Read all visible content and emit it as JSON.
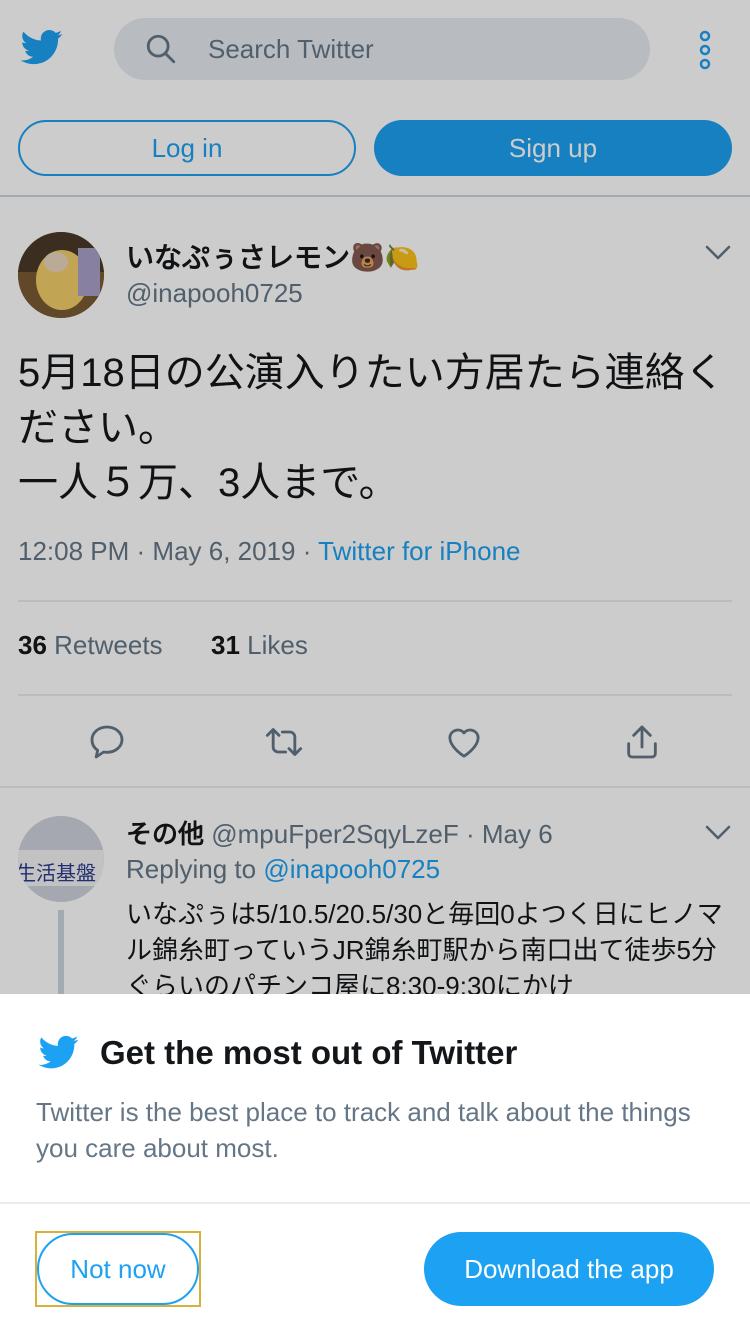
{
  "header": {
    "logo_icon": "twitter-bird-icon",
    "search_placeholder": "Search Twitter",
    "search_icon": "search-icon",
    "more_icon": "more-vertical-icon",
    "login_label": "Log in",
    "signup_label": "Sign up"
  },
  "tweet": {
    "display_name": "いなぷぅさレモン🐻🍋",
    "handle": "@inapooh0725",
    "text": "5月18日の公演入りたい方居たら連絡ください。\n一人５万、3人まで。",
    "time": "12:08 PM",
    "date": "May 6, 2019",
    "source": "Twitter for iPhone",
    "retweets_count": "36",
    "retweets_label": "Retweets",
    "likes_count": "31",
    "likes_label": "Likes"
  },
  "reply": {
    "display_name": "その他",
    "handle": "@mpuFper2SqyLzeF",
    "date": "May 6",
    "replying_label": "Replying to",
    "replying_handle": "@inapooh0725",
    "avatar_text": "生活基盤",
    "text": "いなぷぅは5/10.5/20.5/30と毎回0よつく日にヒノマル錦糸町っていうJR錦糸町駅から南口出て徒歩5分ぐらいのパチンコ屋に8:30-9:30にかけ"
  },
  "sheet": {
    "title": "Get the most out of Twitter",
    "body": "Twitter is the best place to track and talk about the things you care about most.",
    "not_now_label": "Not now",
    "download_label": "Download the app"
  },
  "colors": {
    "accent": "#1da1f2",
    "secondary_text": "#657786",
    "highlight_outline": "#d8b13a"
  }
}
